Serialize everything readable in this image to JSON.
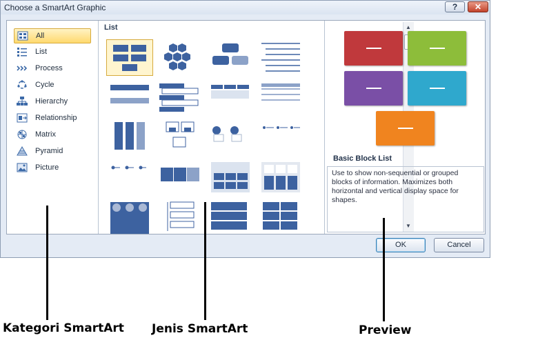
{
  "window": {
    "title": "Choose a SmartArt Graphic"
  },
  "titlebar_buttons": {
    "help": "?",
    "close": "✕"
  },
  "categories": [
    {
      "label": "All",
      "icon": "all-icon",
      "selected": true
    },
    {
      "label": "List",
      "icon": "list-icon"
    },
    {
      "label": "Process",
      "icon": "process-icon"
    },
    {
      "label": "Cycle",
      "icon": "cycle-icon"
    },
    {
      "label": "Hierarchy",
      "icon": "hierarchy-icon"
    },
    {
      "label": "Relationship",
      "icon": "relationship-icon"
    },
    {
      "label": "Matrix",
      "icon": "matrix-icon"
    },
    {
      "label": "Pyramid",
      "icon": "pyramid-icon"
    },
    {
      "label": "Picture",
      "icon": "picture-icon"
    }
  ],
  "gallery": {
    "header": "List"
  },
  "preview": {
    "title": "Basic Block List",
    "description": "Use to show non-sequential or grouped blocks of information. Maximizes both horizontal and vertical display space for shapes.",
    "block_colors": [
      "#c0393c",
      "#8dbd3a",
      "#7a4fa6",
      "#2fa8cd",
      "#f0841f"
    ]
  },
  "buttons": {
    "ok": "OK",
    "cancel": "Cancel"
  },
  "annotations": {
    "categories": "Kategori SmartArt",
    "types": "Jenis SmartArt",
    "preview": "Preview"
  }
}
